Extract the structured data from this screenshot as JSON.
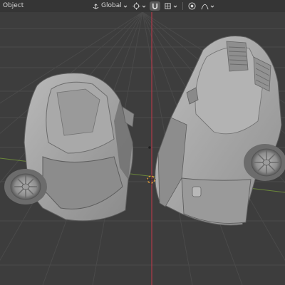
{
  "header": {
    "mode_label": "Object",
    "transform_orientation": "Global"
  },
  "icons": {
    "orientation": "global-orientation-icon",
    "pivot": "pivot-point-icon",
    "snap": "snap-magnet-icon",
    "proportional": "proportional-editing-icon",
    "falloff": "falloff-curve-icon"
  },
  "colors": {
    "viewport_bg": "#3d3d3d",
    "grid": "#4a4a4a",
    "axis_x": "#b03a4a",
    "axis_y": "#7fa83a",
    "mesh": "#a7a7a7",
    "mesh_shadow": "#6a6a6a",
    "origin": "#e8a23a"
  }
}
